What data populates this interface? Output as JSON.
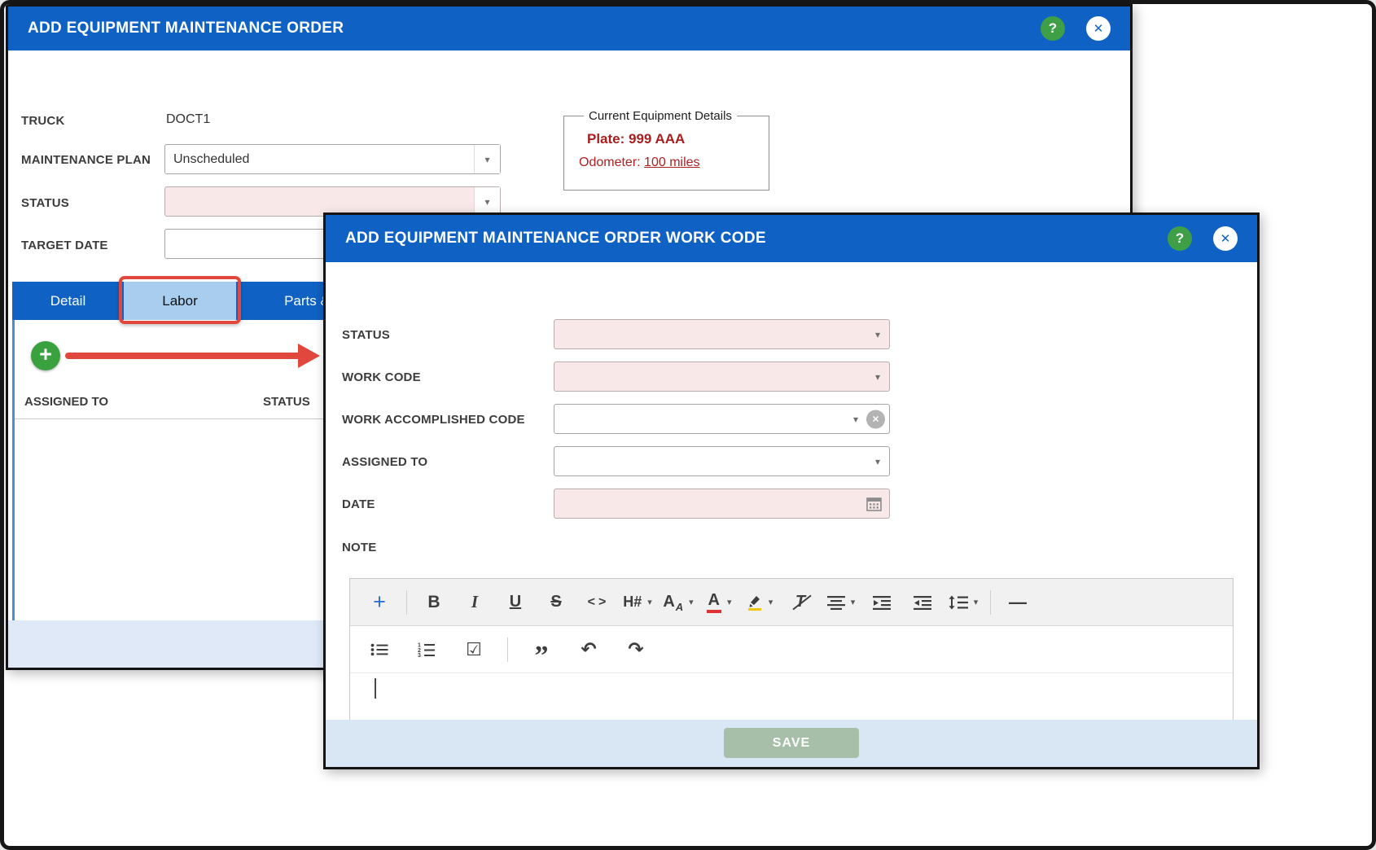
{
  "ui": {
    "help_glyph": "?",
    "close_glyph": "✕",
    "caret_glyph": "▾",
    "clear_glyph": "✕"
  },
  "order_modal": {
    "title": "ADD EQUIPMENT MAINTENANCE ORDER",
    "truck": {
      "label": "TRUCK",
      "value": "DOCT1"
    },
    "maintenance_plan": {
      "label": "MAINTENANCE PLAN",
      "value": "Unscheduled"
    },
    "status": {
      "label": "STATUS",
      "value": ""
    },
    "target_date": {
      "label": "TARGET DATE",
      "value": ""
    },
    "equipment_details": {
      "legend": "Current Equipment Details",
      "plate": "Plate: 999 AAA",
      "odometer_label": "Odometer:",
      "odometer_value": "100 miles"
    },
    "tabs": [
      {
        "label": "Detail"
      },
      {
        "label": "Labor"
      },
      {
        "label": "Parts & S"
      }
    ],
    "add_button_glyph": "+",
    "table_columns": [
      "ASSIGNED TO",
      "STATUS"
    ]
  },
  "workcode_modal": {
    "title": "ADD EQUIPMENT MAINTENANCE ORDER WORK CODE",
    "fields": {
      "status": "STATUS",
      "work_code": "WORK CODE",
      "work_accomplished": "WORK ACCOMPLISHED CODE",
      "assigned_to": "ASSIGNED TO",
      "date": "DATE",
      "note": "NOTE"
    },
    "values": {
      "status": "",
      "work_code": "",
      "work_accomplished": "",
      "assigned_to": "",
      "date": "",
      "note": ""
    },
    "editor": {
      "plus": "+",
      "bold": "B",
      "italic": "I",
      "underline": "U",
      "strikethrough": "S",
      "code": "<>",
      "heading": "H#",
      "font_large": "A",
      "font_small": "A",
      "text_color": "A",
      "clear_format": "T",
      "hr": "—",
      "checklist": "☑",
      "quote": "”",
      "undo": "↶",
      "redo": "↷"
    },
    "save_label": "SAVE"
  }
}
